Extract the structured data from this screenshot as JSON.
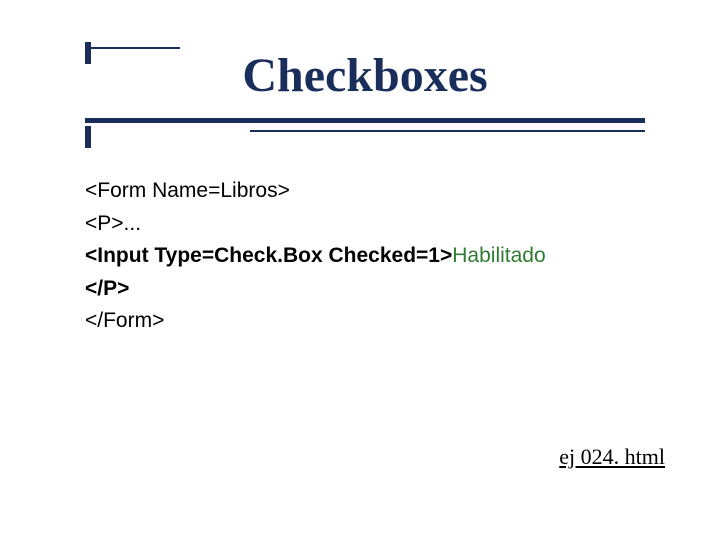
{
  "title": "Checkboxes",
  "code": {
    "l1": "<Form Name=Libros>",
    "l2": "<P>...",
    "l3a": "<Input Type=Check.Box Checked=1>",
    "l3b": "Habilitado",
    "l4": "</P>",
    "l5": "</Form>"
  },
  "footer": "ej 024. html"
}
